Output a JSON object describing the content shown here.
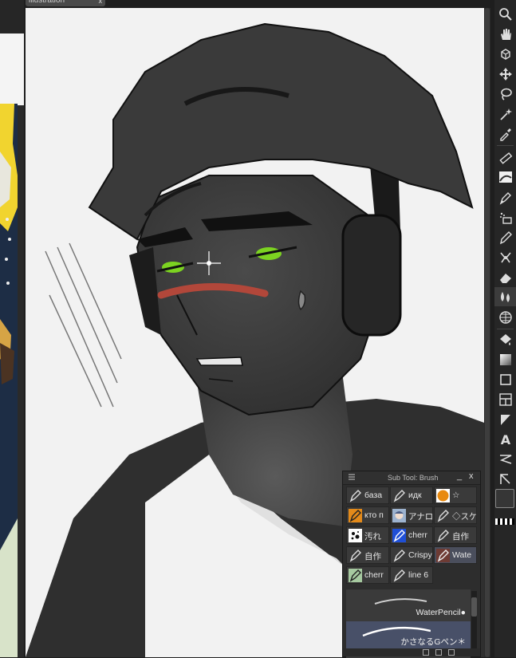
{
  "canvas_tab": {
    "label": "illustration",
    "close": "x"
  },
  "toolbar": {
    "tools": [
      "zoom-icon",
      "hand-icon",
      "rotate-icon",
      "move-icon",
      "lasso-icon",
      "magic-wand-icon",
      "eyedropper-icon",
      "ruler-icon",
      "tone-icon",
      "pen-icon",
      "airbrush-icon",
      "pencil-icon",
      "brush-icon",
      "eraser-icon",
      "blend-icon",
      "grid-icon",
      "fill-icon",
      "gradient-icon",
      "figure-icon",
      "frame-icon",
      "ruler-line-icon",
      "text-icon",
      "balloon-icon",
      "correct-line-icon"
    ]
  },
  "subtool_panel": {
    "title": "Sub Tool: Brush",
    "minimize": "_",
    "close": "x",
    "presets": [
      {
        "label": "база",
        "icon": "pen-icon"
      },
      {
        "label": "идк",
        "icon": "pen-icon"
      },
      {
        "label": "☆",
        "icon": "orange-ball-icon"
      },
      {
        "label": "кто п",
        "icon": "pen-orange-icon"
      },
      {
        "label": "アナロ",
        "icon": "anime-face-icon"
      },
      {
        "label": "◇スケ",
        "icon": "pen-icon"
      },
      {
        "label": "汚れ",
        "icon": "splatter-icon"
      },
      {
        "label": "cherr",
        "icon": "blue-pen-icon"
      },
      {
        "label": "自作",
        "icon": "pen-icon"
      },
      {
        "label": "自作",
        "icon": "pen-icon"
      },
      {
        "label": "Crispy",
        "icon": "pen-icon"
      },
      {
        "label": "Wate",
        "icon": "red-pen-icon"
      },
      {
        "label": "cherr",
        "icon": "green-pen-icon"
      },
      {
        "label": "line 6",
        "icon": "pen-icon"
      }
    ],
    "strokes": [
      {
        "label": "WaterPencil●"
      },
      {
        "label": "かさなるGペン＊"
      }
    ]
  },
  "colors": {
    "accent": "#485068",
    "skin": "#3b3b3b",
    "eyes": "#7cd321",
    "blush": "#b2473a"
  }
}
